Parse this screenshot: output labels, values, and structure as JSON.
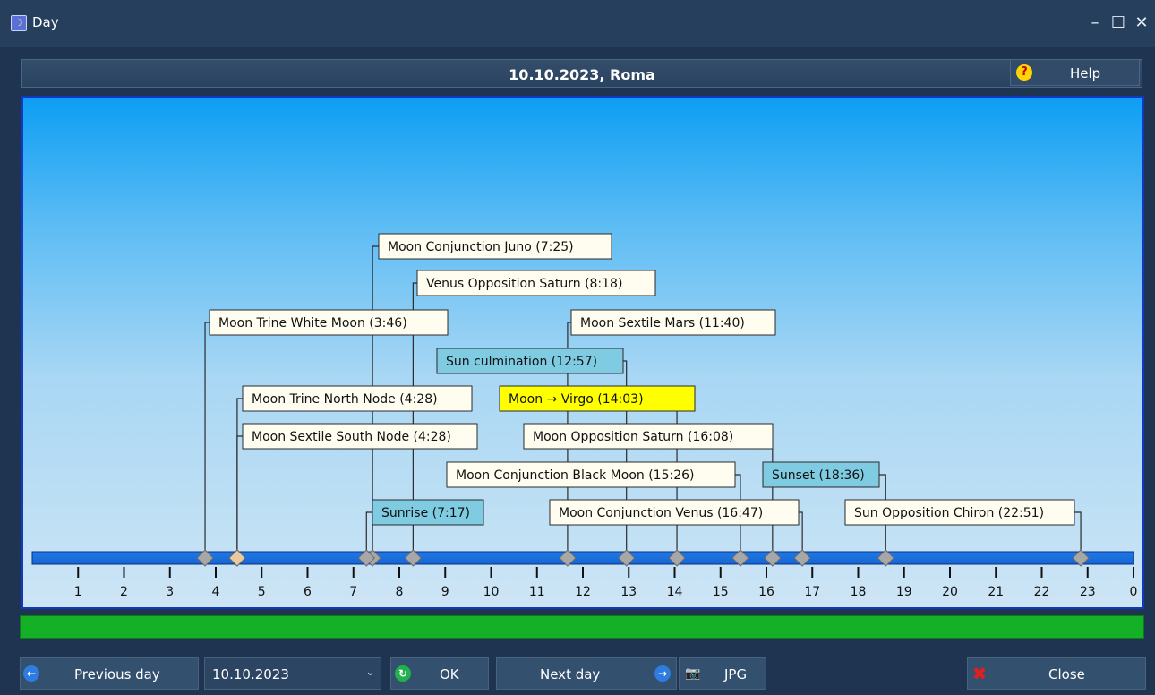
{
  "window": {
    "title": "Day",
    "controls": {
      "minimize": "–",
      "maximize": "☐",
      "close": "✕"
    }
  },
  "header": {
    "title": "10.10.2023, Roma",
    "help_label": "Help",
    "help_icon": "question-icon"
  },
  "timeline": {
    "hour_labels": [
      "1",
      "2",
      "3",
      "4",
      "5",
      "6",
      "7",
      "8",
      "9",
      "10",
      "11",
      "12",
      "13",
      "14",
      "15",
      "16",
      "17",
      "18",
      "19",
      "20",
      "21",
      "22",
      "23",
      "0"
    ],
    "events": [
      {
        "label": "Moon Conjunction Juno (7:25)",
        "time": "7:25",
        "kind": "aspect"
      },
      {
        "label": "Venus Opposition Saturn (8:18)",
        "time": "8:18",
        "kind": "aspect"
      },
      {
        "label": "Moon Trine White Moon (3:46)",
        "time": "3:46",
        "kind": "aspect"
      },
      {
        "label": "Moon Sextile Mars (11:40)",
        "time": "11:40",
        "kind": "aspect"
      },
      {
        "label": "Sun culmination (12:57)",
        "time": "12:57",
        "kind": "sun"
      },
      {
        "label": "Moon Trine North Node (4:28)",
        "time": "4:28",
        "kind": "aspect"
      },
      {
        "label": "Moon → Virgo (14:03)",
        "time": "14:03",
        "kind": "ingress"
      },
      {
        "label": "Moon Sextile South Node (4:28)",
        "time": "4:28",
        "kind": "aspect"
      },
      {
        "label": "Moon Opposition Saturn (16:08)",
        "time": "16:08",
        "kind": "aspect"
      },
      {
        "label": "Moon Conjunction Black Moon (15:26)",
        "time": "15:26",
        "kind": "aspect"
      },
      {
        "label": "Sunset (18:36)",
        "time": "18:36",
        "kind": "sun"
      },
      {
        "label": "Sunrise (7:17)",
        "time": "7:17",
        "kind": "sun"
      },
      {
        "label": "Moon Conjunction Venus (16:47)",
        "time": "16:47",
        "kind": "aspect"
      },
      {
        "label": "Sun Opposition Chiron (22:51)",
        "time": "22:51",
        "kind": "aspect"
      }
    ],
    "colors": {
      "aspect_bg": "#fffdf0",
      "sun_bg": "#7fcbe2",
      "ingress_bg": "#ffff00",
      "bar": "#1565d0",
      "marker": "#a7a7a7"
    }
  },
  "progress": {
    "value": 1.0,
    "color": "#14b026"
  },
  "footer": {
    "previous_label": "Previous day",
    "date_value": "10.10.2023",
    "ok_label": "OK",
    "next_label": "Next day",
    "jpg_label": "JPG",
    "close_label": "Close"
  }
}
